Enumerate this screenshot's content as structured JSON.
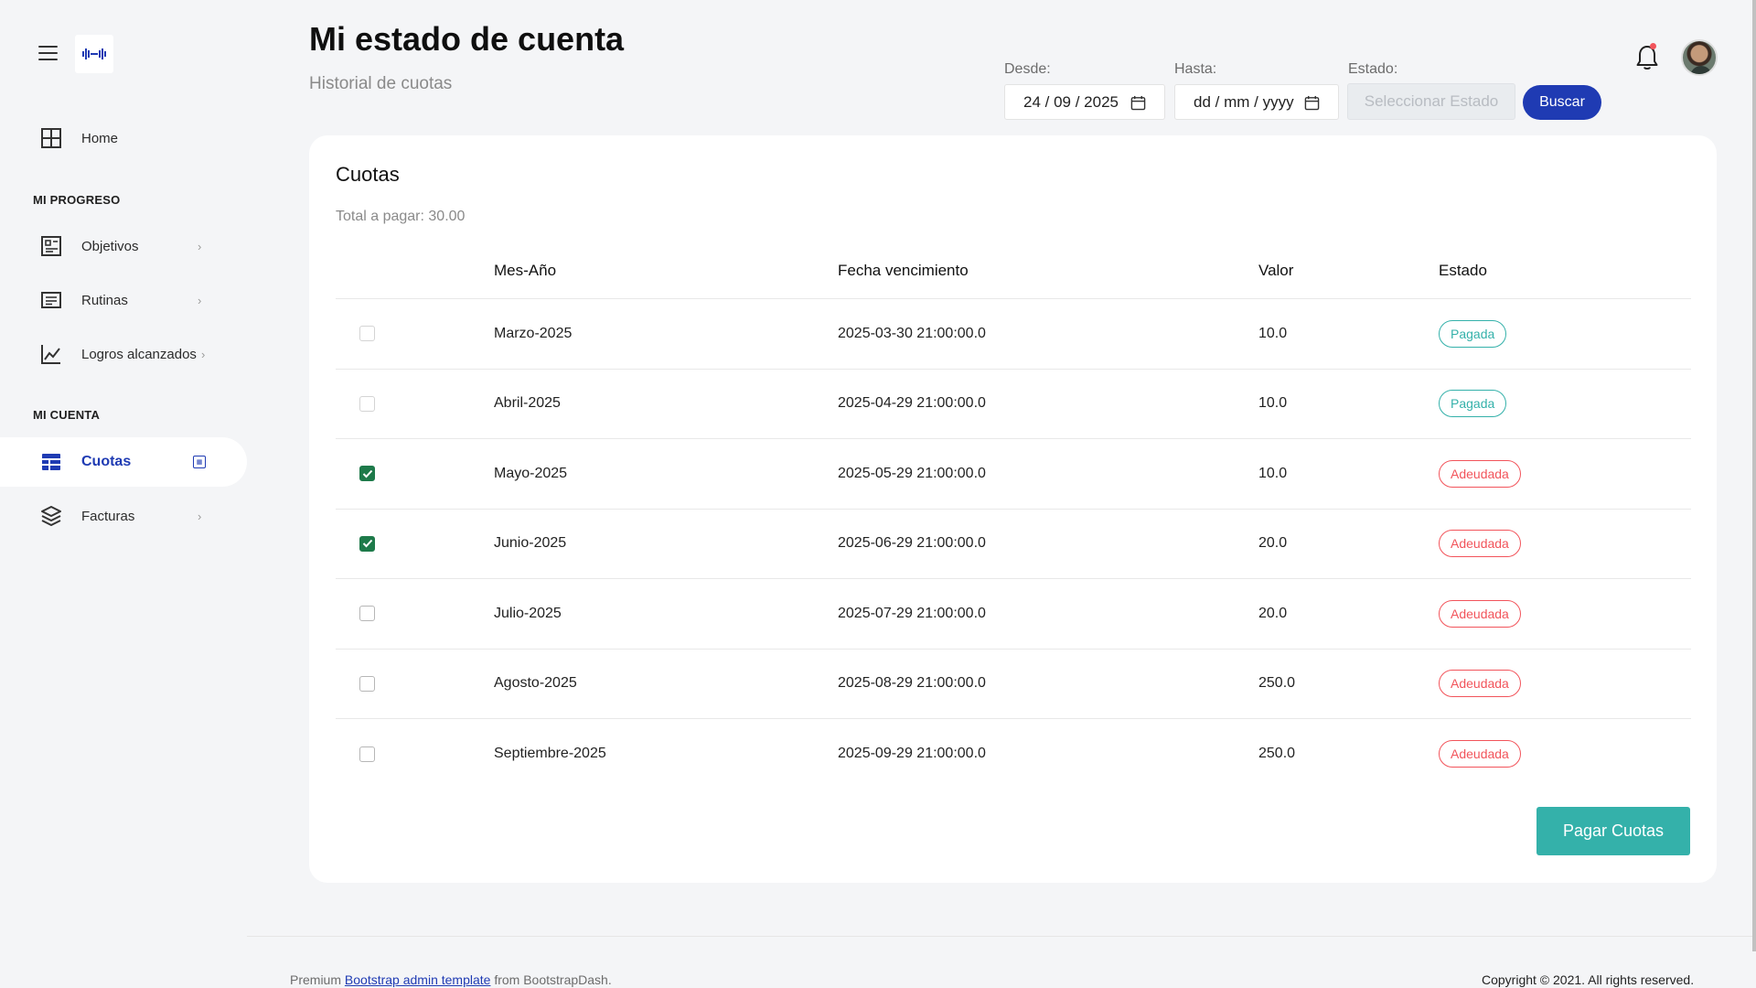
{
  "sidebar": {
    "home": "Home",
    "section_progress": "MI PROGRESO",
    "objetivos": "Objetivos",
    "rutinas": "Rutinas",
    "logros": "Logros alcanzados",
    "section_account": "MI CUENTA",
    "cuotas": "Cuotas",
    "facturas": "Facturas",
    "chevron": "›"
  },
  "header": {
    "title": "Mi estado de cuenta",
    "subtitle": "Historial de cuotas"
  },
  "filters": {
    "desde_label": "Desde:",
    "desde_value": "24 / 09 / 2025",
    "hasta_label": "Hasta:",
    "hasta_value": "dd / mm / yyyy",
    "estado_label": "Estado:",
    "estado_placeholder": "Seleccionar Estado",
    "search_button": "Buscar"
  },
  "card": {
    "title": "Cuotas",
    "total": "Total a pagar: 30.00",
    "pay_button": "Pagar Cuotas"
  },
  "table": {
    "headers": [
      "Mes-Año",
      "Fecha vencimiento",
      "Valor",
      "Estado"
    ],
    "rows": [
      {
        "mes": "Marzo-2025",
        "fecha": "2025-03-30 21:00:00.0",
        "valor": "10.0",
        "estado": "Pagada",
        "checked": false
      },
      {
        "mes": "Abril-2025",
        "fecha": "2025-04-29 21:00:00.0",
        "valor": "10.0",
        "estado": "Pagada",
        "checked": false
      },
      {
        "mes": "Mayo-2025",
        "fecha": "2025-05-29 21:00:00.0",
        "valor": "10.0",
        "estado": "Adeudada",
        "checked": true
      },
      {
        "mes": "Junio-2025",
        "fecha": "2025-06-29 21:00:00.0",
        "valor": "20.0",
        "estado": "Adeudada",
        "checked": true
      },
      {
        "mes": "Julio-2025",
        "fecha": "2025-07-29 21:00:00.0",
        "valor": "20.0",
        "estado": "Adeudada",
        "checked": false
      },
      {
        "mes": "Agosto-2025",
        "fecha": "2025-08-29 21:00:00.0",
        "valor": "250.0",
        "estado": "Adeudada",
        "checked": false
      },
      {
        "mes": "Septiembre-2025",
        "fecha": "2025-09-29 21:00:00.0",
        "valor": "250.0",
        "estado": "Adeudada",
        "checked": false
      }
    ]
  },
  "footer": {
    "prefix": "Premium",
    "link": "Bootstrap admin template",
    "suffix": "from BootstrapDash.",
    "copyright": "Copyright © 2021. All rights reserved."
  },
  "colors": {
    "primary": "#1f3bb3",
    "teal": "#34b1aa",
    "danger": "#f2545b",
    "checkbox_checked": "#1e7a4a"
  },
  "icons": {
    "menu": "hamburger-icon",
    "home": "grid-icon",
    "objetivos": "layout-icon",
    "rutinas": "list-icon",
    "logros": "chart-line-icon",
    "cuotas": "table-icon",
    "facturas": "layers-icon",
    "notifications": "bell-icon",
    "calendar": "calendar-icon"
  }
}
